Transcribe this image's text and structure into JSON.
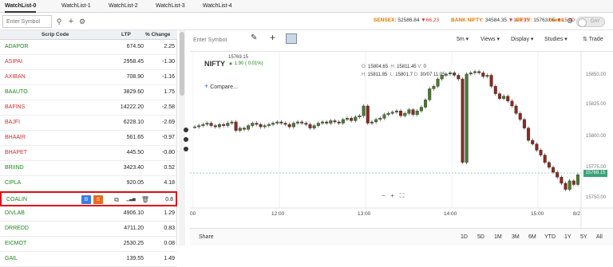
{
  "tabs": [
    "WatchList-0",
    "WatchList-1",
    "WatchList-2",
    "WatchList-3",
    "WatchList-4"
  ],
  "search_placeholder": "Enter Symbol",
  "tickers": {
    "sensex_label": "SENSEX:",
    "sensex_value": "52586.84",
    "sensex_change": "▼66.23",
    "banknifty_label": "BANK NIFTY:",
    "banknifty_value": "34584.35",
    "banknifty_change": "▼107.15",
    "nifty_label": "NIFTY:",
    "nifty_value": "15763.05",
    "nifty_change": "▼15.40",
    "feeds_label": "Feeds"
  },
  "toggle_label": "DAY",
  "columns": [
    "Scrip Code",
    "LTP",
    "% Change"
  ],
  "rows": [
    {
      "sym": "ADAPOR",
      "ltp": "674.50",
      "chg": "2.25",
      "dir": "up"
    },
    {
      "sym": "ASIPAI",
      "ltp": "2958.45",
      "chg": "-1.30",
      "dir": "dn"
    },
    {
      "sym": "AXIBAN",
      "ltp": "708.90",
      "chg": "-1.16",
      "dir": "dn"
    },
    {
      "sym": "BAAUTO",
      "ltp": "3829.60",
      "chg": "1.75",
      "dir": "up"
    },
    {
      "sym": "BAFINS",
      "ltp": "14222.20",
      "chg": "-2.58",
      "dir": "dn"
    },
    {
      "sym": "BAJFI",
      "ltp": "6228.10",
      "chg": "-2.69",
      "dir": "dn"
    },
    {
      "sym": "BHAAIR",
      "ltp": "561.65",
      "chg": "-0.97",
      "dir": "dn"
    },
    {
      "sym": "BHAPET",
      "ltp": "445.50",
      "chg": "-0.80",
      "dir": "dn"
    },
    {
      "sym": "BRIIND",
      "ltp": "3423.40",
      "chg": "0.52",
      "dir": "up"
    },
    {
      "sym": "CIPLA",
      "ltp": "920.05",
      "chg": "4.18",
      "dir": "up"
    },
    {
      "sym": "COALIN",
      "ltp": "",
      "chg": "0.8",
      "dir": "up"
    },
    {
      "sym": "DIVLAB",
      "ltp": "4906.10",
      "chg": "1.29",
      "dir": "up"
    },
    {
      "sym": "DRREDD",
      "ltp": "4711.20",
      "chg": "0.83",
      "dir": "up"
    },
    {
      "sym": "EICMOT",
      "ltp": "2530.25",
      "chg": "0.08",
      "dir": "up"
    },
    {
      "sym": "GAIL",
      "ltp": "139.55",
      "chg": "1.49",
      "dir": "up"
    }
  ],
  "row_actions": {
    "buy": "B",
    "sell": "S"
  },
  "chart_toolbar": {
    "interval": "5m",
    "views": "Views",
    "display": "Display",
    "studies": "Studies",
    "trade": "Trade"
  },
  "chart": {
    "symbol": "NIFTY",
    "price": "15769.15",
    "change": "▲ 1.90 ( 0.01%)",
    "compare": "Compare...",
    "ohlc_o": "O:",
    "ohlc_o_val": "15804.65",
    "ohlc_h": "H:",
    "ohlc_h_val": "15811.45",
    "ohlc_v": "V:",
    "ohlc_v_val": "0",
    "ohlc_l": "L:",
    "ohlc_l_val": "15801.7",
    "ohlc_c": "C:",
    "ohlc_c_val": "15811.85",
    "ohlc_d": "D:",
    "ohlc_d_val": "30/07 11:05",
    "y_ticks": [
      "15850.00",
      "15825.00",
      "15800.00",
      "15775.00",
      "15750.00"
    ],
    "x_ticks": [
      "00",
      "12:00",
      "13:00",
      "14:00",
      "15:00",
      "8/2"
    ],
    "price_tag": "15768.15",
    "share": "Share",
    "ranges": [
      "1D",
      "5D",
      "1M",
      "3M",
      "6M",
      "YTD",
      "1Y",
      "5Y",
      "All"
    ]
  },
  "colors": {
    "up": "#1a8a1a",
    "down": "#d32f2f",
    "candle_up": "#4a7a2c",
    "candle_down": "#8b2a1f",
    "accent": "#e07a00"
  }
}
